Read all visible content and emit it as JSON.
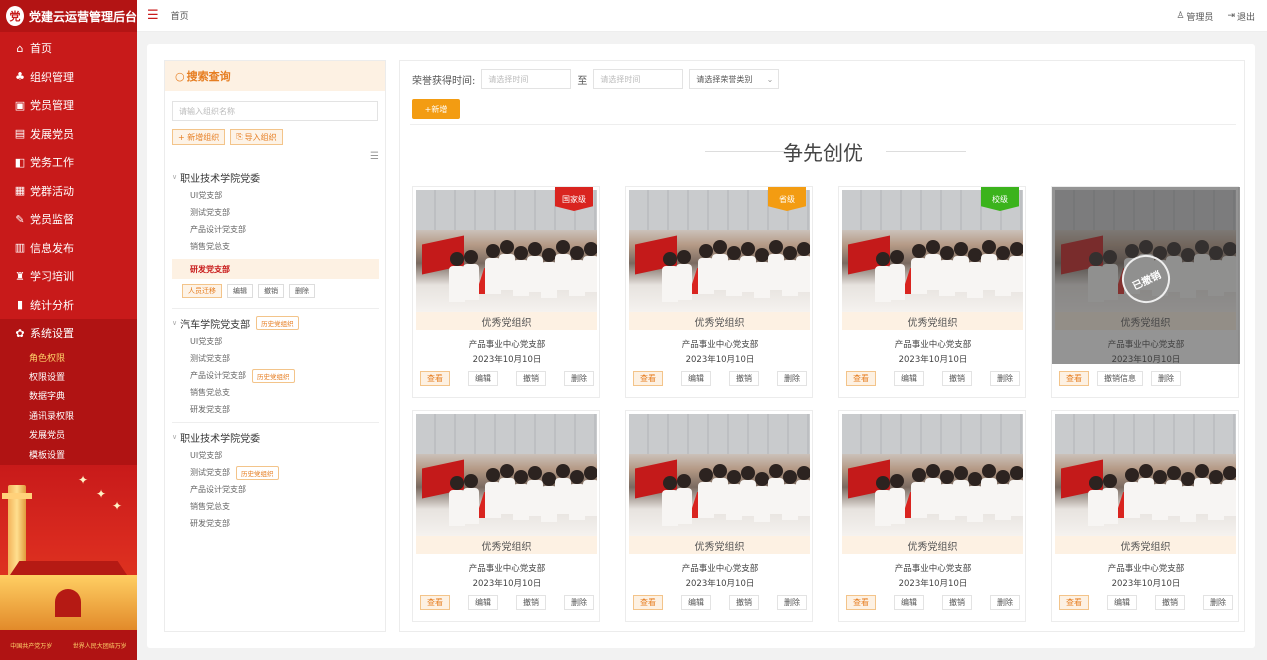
{
  "app": {
    "title": "党建云运营管理后台",
    "logo_text": "党"
  },
  "sidebar": {
    "items": [
      {
        "label": "首页",
        "icon": "home-icon",
        "glyph": "⌂"
      },
      {
        "label": "组织管理",
        "icon": "org-chart-icon",
        "glyph": "♣"
      },
      {
        "label": "党员管理",
        "icon": "id-card-icon",
        "glyph": "▣"
      },
      {
        "label": "发展党员",
        "icon": "document-icon",
        "glyph": "▤"
      },
      {
        "label": "党务工作",
        "icon": "folder-icon",
        "glyph": "◧"
      },
      {
        "label": "党群活动",
        "icon": "calendar-icon",
        "glyph": "▦"
      },
      {
        "label": "党员监督",
        "icon": "edit-icon",
        "glyph": "✎"
      },
      {
        "label": "信息发布",
        "icon": "message-icon",
        "glyph": "▥"
      },
      {
        "label": "学习培训",
        "icon": "book-icon",
        "glyph": "♜"
      },
      {
        "label": "统计分析",
        "icon": "bar-chart-icon",
        "glyph": "▮"
      },
      {
        "label": "系统设置",
        "icon": "gear-icon",
        "glyph": "✿"
      }
    ],
    "sub_items": [
      "角色权限",
      "权限设置",
      "数据字典",
      "通讯录权限",
      "发展党员",
      "模板设置"
    ],
    "active_sub": "角色权限",
    "footer_texts": [
      "中国共产党万岁",
      "世界人民大团结万岁"
    ]
  },
  "topbar": {
    "breadcrumb": "首页",
    "user_label": "管理员",
    "logout_label": "退出"
  },
  "tree": {
    "title": "搜索查询",
    "search_placeholder": "请输入组织名称",
    "add_label": "+ 新增组织",
    "import_label": "导入组织",
    "group1": {
      "name": "职业技术学院党委",
      "children": [
        "UI党支部",
        "测试党支部",
        "产品设计党支部",
        "销售党总支"
      ],
      "active": "研发党支部"
    },
    "ops": [
      "人员迁移",
      "编辑",
      "撤销",
      "删除"
    ],
    "group2": {
      "name": "汽车学院党支部",
      "tag": "历史党组织",
      "children": [
        "UI党支部",
        "测试党支部",
        "产品设计党支部",
        "销售党总支",
        "研发党支部"
      ],
      "child_tag": "历史党组织"
    },
    "group3": {
      "name": "职业技术学院党委",
      "children": [
        "UI党支部",
        "测试党支部",
        "产品设计党支部",
        "销售党总支",
        "研发党支部"
      ],
      "child_tag": "历史党组织"
    }
  },
  "filter": {
    "label": "荣誉获得时间:",
    "start_placeholder": "请选择时间",
    "to": "至",
    "end_placeholder": "请选择时间",
    "category_placeholder": "请选择荣誉类别"
  },
  "add_button": "+新增",
  "section_title": "争先创优",
  "cards": [
    {
      "caption": "优秀党组织",
      "org": "产品事业中心党支部",
      "date": "2023年10月10日",
      "badge": "国家级",
      "badge_color": "#d9241f",
      "revoked": false
    },
    {
      "caption": "优秀党组织",
      "org": "产品事业中心党支部",
      "date": "2023年10月10日",
      "badge": "省级",
      "badge_color": "#f39c12",
      "revoked": false
    },
    {
      "caption": "优秀党组织",
      "org": "产品事业中心党支部",
      "date": "2023年10月10日",
      "badge": "校级",
      "badge_color": "#3bb31c",
      "revoked": false
    },
    {
      "caption": "优秀党组织",
      "org": "产品事业中心党支部",
      "date": "2023年10月10日",
      "badge": "",
      "badge_color": "",
      "revoked": true,
      "stamp": "已撤销"
    },
    {
      "caption": "优秀党组织",
      "org": "产品事业中心党支部",
      "date": "2023年10月10日",
      "badge": "",
      "badge_color": "",
      "revoked": false
    },
    {
      "caption": "优秀党组织",
      "org": "产品事业中心党支部",
      "date": "2023年10月10日",
      "badge": "",
      "badge_color": "",
      "revoked": false
    },
    {
      "caption": "优秀党组织",
      "org": "产品事业中心党支部",
      "date": "2023年10月10日",
      "badge": "",
      "badge_color": "",
      "revoked": false
    },
    {
      "caption": "优秀党组织",
      "org": "产品事业中心党支部",
      "date": "2023年10月10日",
      "badge": "",
      "badge_color": "",
      "revoked": false
    }
  ],
  "card_ops": [
    "查看",
    "编辑",
    "撤销",
    "删除"
  ],
  "revoked_ops": [
    "查看",
    "撤销信息",
    "删除"
  ],
  "colors": {
    "primary": "#c81a1a",
    "accent": "#f39c12"
  }
}
